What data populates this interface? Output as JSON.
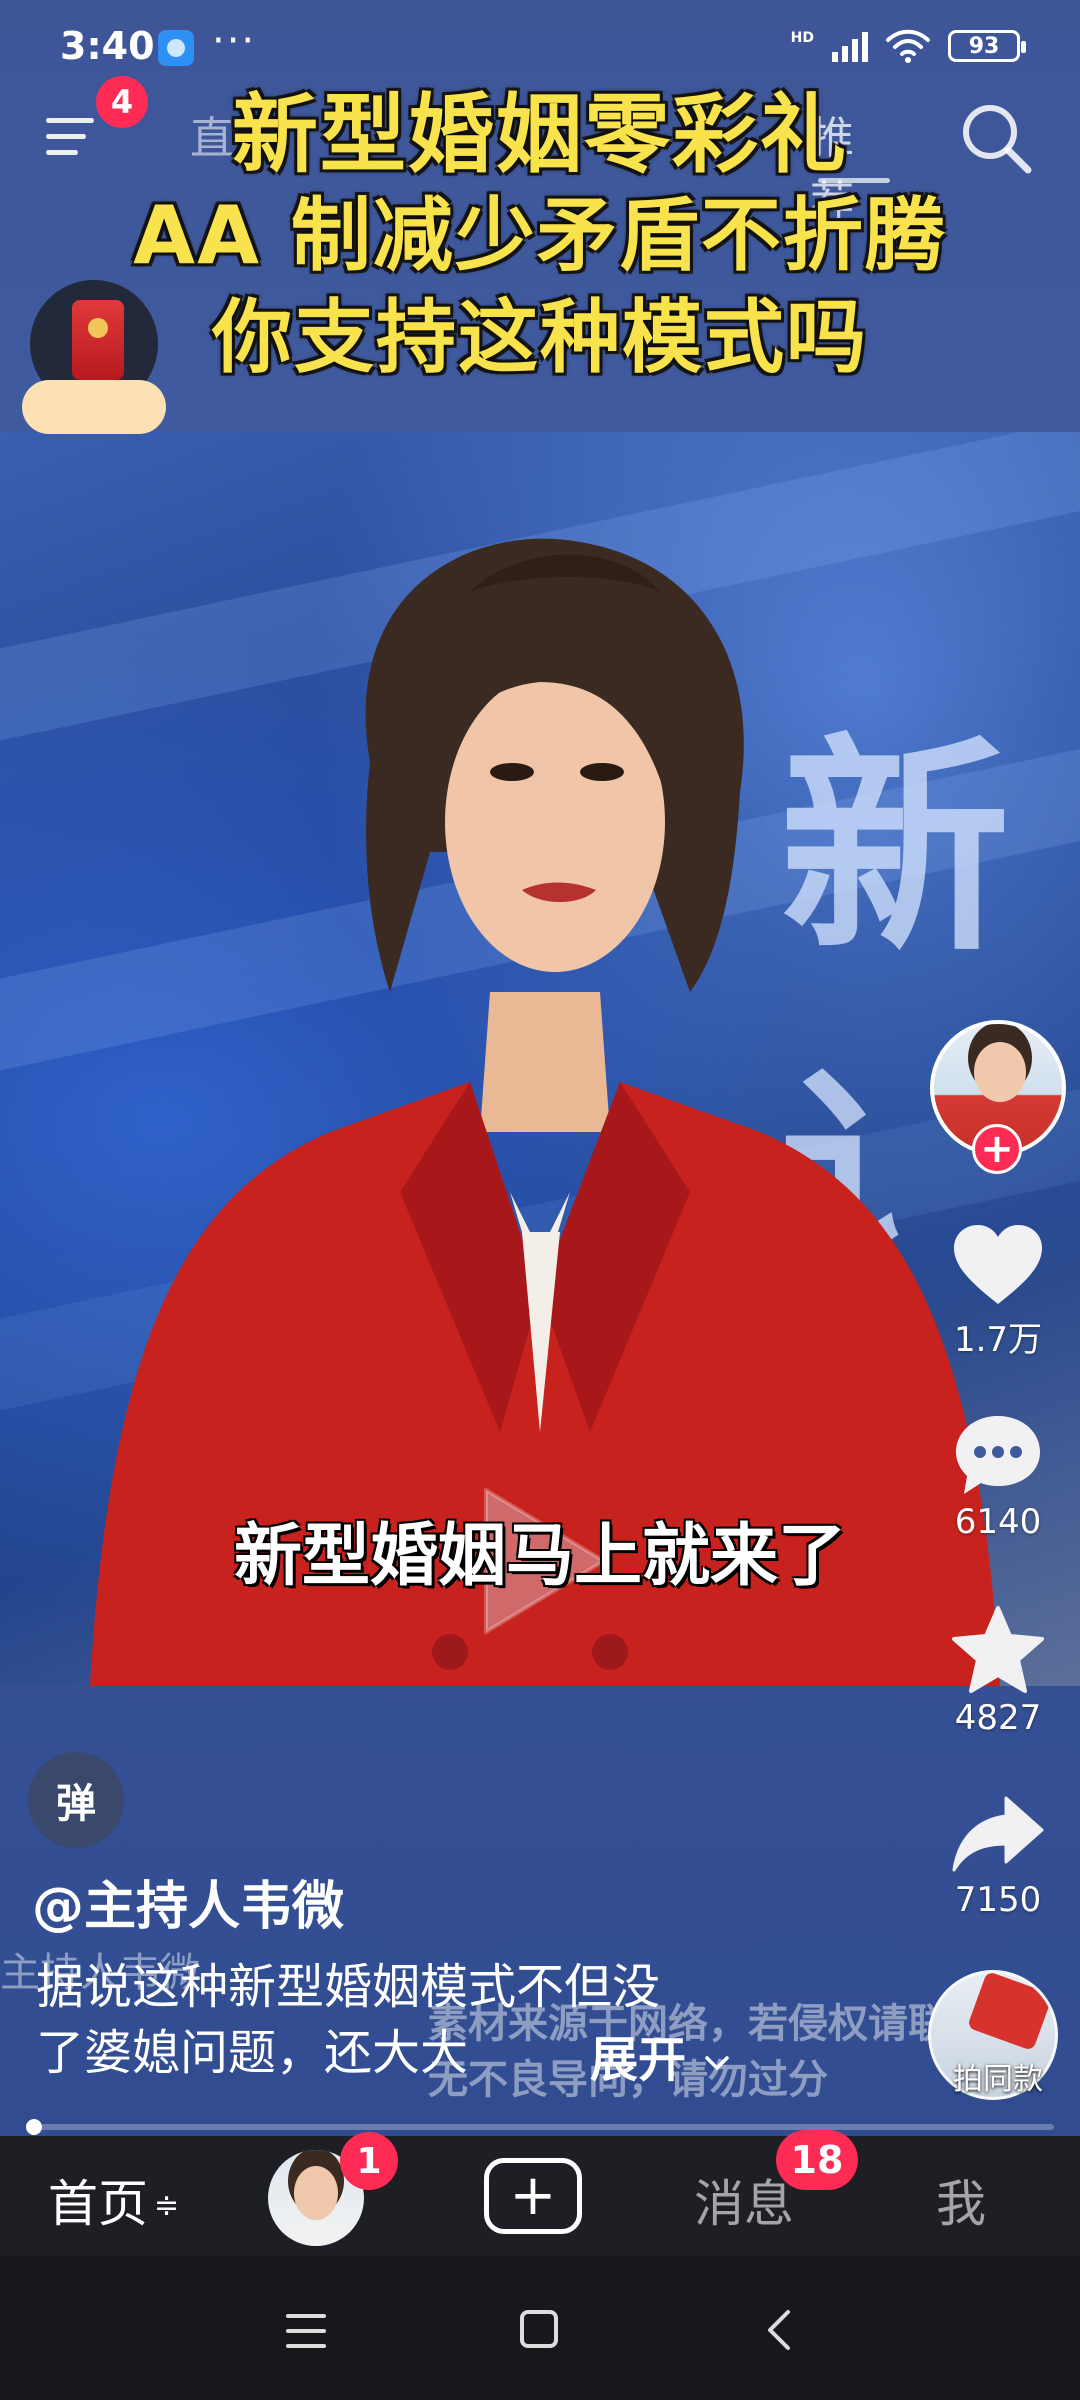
{
  "status_bar": {
    "time": "3:40",
    "more": "···",
    "network_label": "HD",
    "battery": "93"
  },
  "top_nav": {
    "menu_badge": "4",
    "tab_live": "直",
    "tab_recommend": "推荐"
  },
  "video": {
    "title_lines": [
      "新型婚姻零彩礼",
      "AA 制减少矛盾不折腾",
      "你支持这种模式吗"
    ],
    "background_text": "新讠",
    "subtitle": "新型婚姻马上就来了"
  },
  "actions": {
    "likes": "1.7万",
    "comments": "6140",
    "favorites": "4827",
    "shares": "7150",
    "follow_plus": "+",
    "same_style_label": "拍同款"
  },
  "info": {
    "danmaku_label": "弹",
    "author": "@主持人韦微",
    "watermark_name": "主持人韦微",
    "caption_lines": [
      "据说这种新型婚姻模式不但没",
      "了婆媳问题，还大大"
    ],
    "expand": "展开",
    "source_watermark_lines": [
      "素材来源于网络，若侵权请联",
      "无不良导向，请勿过分"
    ],
    "progress": 0.0
  },
  "tab_bar": {
    "home": "首页",
    "home_icon": "≑",
    "avatar_badge": "1",
    "create": "+",
    "messages": "消息",
    "messages_badge": "18",
    "me": "我"
  },
  "colors": {
    "accent": "#fe2c55",
    "title_yellow": "#f8e34c",
    "suit_red": "#c8221e"
  },
  "icons": {
    "menu": "menu-icon",
    "search": "search-icon",
    "like": "heart-icon",
    "comment": "comment-icon",
    "favorite": "star-icon",
    "share": "share-icon",
    "play": "play-icon"
  }
}
